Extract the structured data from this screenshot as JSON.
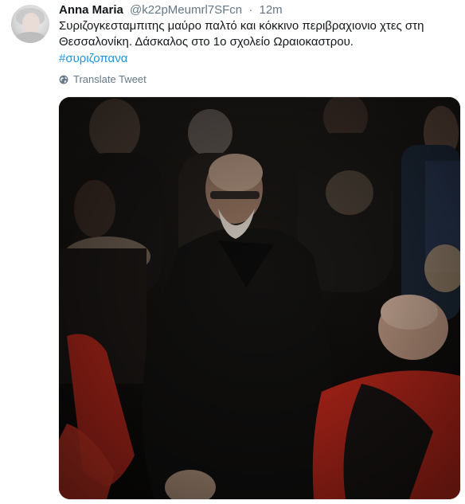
{
  "tweet": {
    "name": "Anna Maria",
    "handle": "@k22pMeumrl7SFcn",
    "separator": "·",
    "time": "12m",
    "text": "Συριζογκεσταμπιτης μαύρο παλτό και κόκκινο περιβραχιονιο χτες στη Θεσσαλονίκη. Δάσκαλος στο 1ο σχολείο Ωραιοκαστρου.",
    "hashtag": "#συριζοπανα",
    "translate_label": "Translate Tweet"
  },
  "colors": {
    "text": "#14171a",
    "secondary": "#657786",
    "link": "#1b95e0"
  },
  "icons": {
    "translate": "globe-icon"
  }
}
